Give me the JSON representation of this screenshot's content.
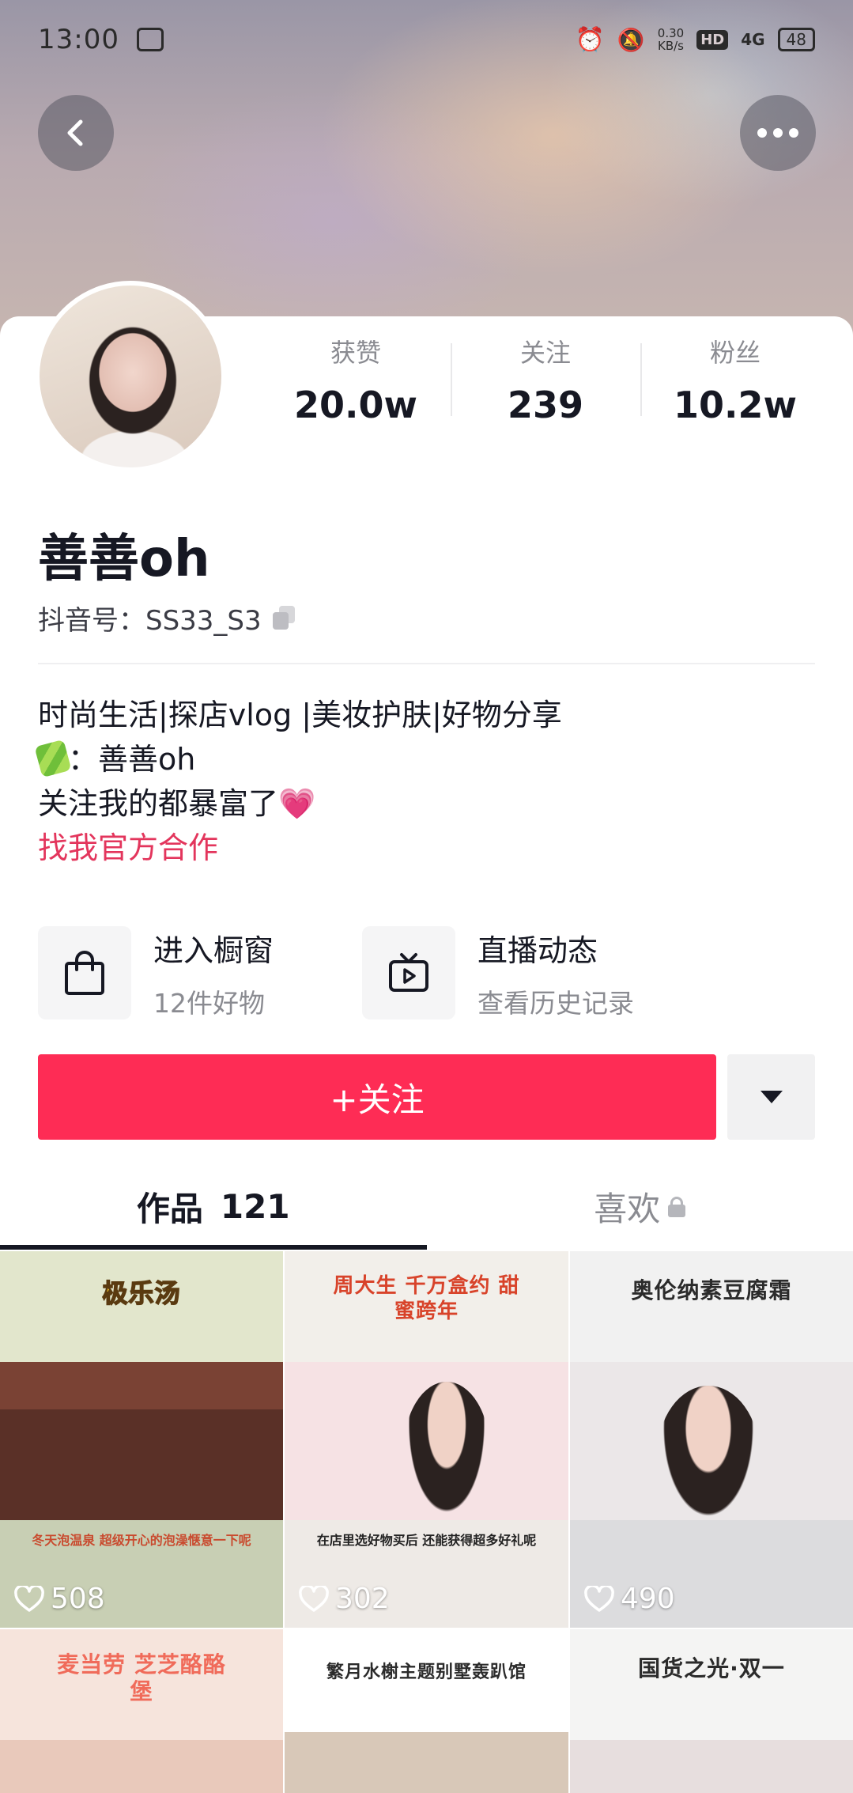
{
  "status_bar": {
    "time": "13:00",
    "net_speed_value": "0.30",
    "net_speed_unit": "KB/s",
    "hd": "HD",
    "signal": "4G",
    "battery": "48"
  },
  "profile": {
    "stats": [
      {
        "label": "获赞",
        "value": "20.0w"
      },
      {
        "label": "关注",
        "value": "239"
      },
      {
        "label": "粉丝",
        "value": "10.2w"
      }
    ],
    "nickname": "善善oh",
    "douyin_id": "抖音号：SS33_S3",
    "bio": {
      "line1": "时尚生活|探店vlog  |美妆护肤|好物分享",
      "line2_text": "：善善oh",
      "line3_text": "关注我的都暴富了",
      "heart": "💗",
      "link": "找我官方合作"
    }
  },
  "shortcuts": [
    {
      "title": "进入橱窗",
      "subtitle": "12件好物",
      "icon": "shopping-bag-icon"
    },
    {
      "title": "直播动态",
      "subtitle": "查看历史记录",
      "icon": "tv-icon"
    }
  ],
  "actions": {
    "follow_label": "+关注"
  },
  "tabs": {
    "works_label": "作品",
    "works_count": "121",
    "likes_label": "喜欢"
  },
  "videos": [
    {
      "title": "极乐汤",
      "caption": "冬天泡温泉 超级开心的泡澡惬意一下呢",
      "likes": "508"
    },
    {
      "title": "周大生 千万盒约 甜蜜跨年",
      "caption": "在店里选好物买后 还能获得超多好礼呢",
      "likes": "302"
    },
    {
      "title": "奥伦纳素豆腐霜",
      "caption": "",
      "likes": "490"
    },
    {
      "title": "麦当劳 芝芝酪酪堡",
      "caption": "",
      "likes": ""
    },
    {
      "title": "繁月水榭主题别墅轰趴馆",
      "caption": "",
      "likes": ""
    },
    {
      "title": "国货之光·双一",
      "caption": "",
      "likes": ""
    }
  ]
}
